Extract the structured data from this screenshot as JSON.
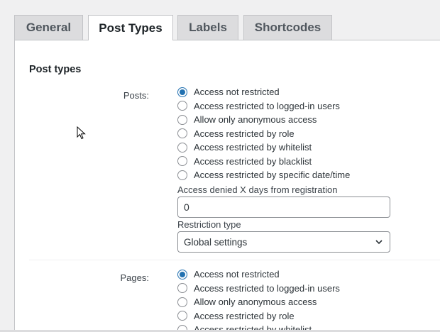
{
  "tabs": [
    {
      "label": "General",
      "active": false
    },
    {
      "label": "Post Types",
      "active": true
    },
    {
      "label": "Labels",
      "active": false
    },
    {
      "label": "Shortcodes",
      "active": false
    }
  ],
  "section_title": "Post types",
  "posts": {
    "label": "Posts:",
    "options": [
      {
        "label": "Access not restricted",
        "checked": true
      },
      {
        "label": "Access restricted to logged-in users",
        "checked": false
      },
      {
        "label": "Allow only anonymous access",
        "checked": false
      },
      {
        "label": "Access restricted by role",
        "checked": false
      },
      {
        "label": "Access restricted by whitelist",
        "checked": false
      },
      {
        "label": "Access restricted by blacklist",
        "checked": false
      },
      {
        "label": "Access restricted by specific date/time",
        "checked": false
      }
    ],
    "days_label": "Access denied X days from registration",
    "days_value": "0",
    "restriction_label": "Restriction type",
    "restriction_value": "Global settings"
  },
  "pages": {
    "label": "Pages:",
    "options": [
      {
        "label": "Access not restricted",
        "checked": true
      },
      {
        "label": "Access restricted to logged-in users",
        "checked": false
      },
      {
        "label": "Allow only anonymous access",
        "checked": false
      },
      {
        "label": "Access restricted by role",
        "checked": false
      },
      {
        "label": "Access restricted by whitelist",
        "checked": false
      }
    ]
  },
  "colors": {
    "accent": "#2271b1",
    "background": "#f0f0f1",
    "panel": "#ffffff"
  }
}
